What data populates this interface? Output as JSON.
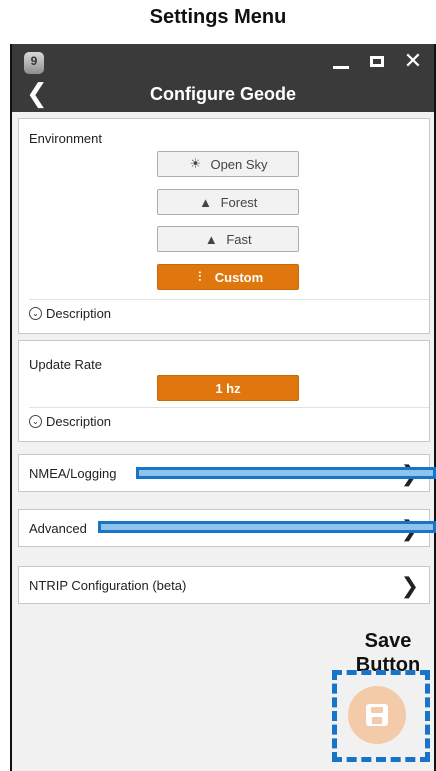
{
  "page_heading": "Settings Menu",
  "titlebar": {
    "logo_text": "9",
    "title": "Configure Geode",
    "back_icon": "chevron-left-icon",
    "controls": [
      "minimize-icon",
      "maximize-icon",
      "close-icon"
    ]
  },
  "environment": {
    "title": "Environment",
    "options": [
      {
        "label": "Open Sky",
        "icon": "sun-icon",
        "active": false
      },
      {
        "label": "Forest",
        "icon": "trees-icon",
        "active": false
      },
      {
        "label": "Fast",
        "icon": "road-icon",
        "active": false
      },
      {
        "label": "Custom",
        "icon": "sliders-icon",
        "active": true
      }
    ],
    "description_label": "Description"
  },
  "update_rate": {
    "title": "Update Rate",
    "value": "1 hz",
    "description_label": "Description"
  },
  "nav_rows": [
    {
      "label": "NMEA/Logging"
    },
    {
      "label": "Advanced"
    },
    {
      "label": "NTRIP Configuration (beta)"
    }
  ],
  "save_annotation": {
    "line1": "Save",
    "line2": "Button"
  },
  "colors": {
    "accent": "#e0770e",
    "annotation_blue": "#1874c8",
    "fab": "#f3cba9",
    "titlebar": "#3a3a3a"
  }
}
